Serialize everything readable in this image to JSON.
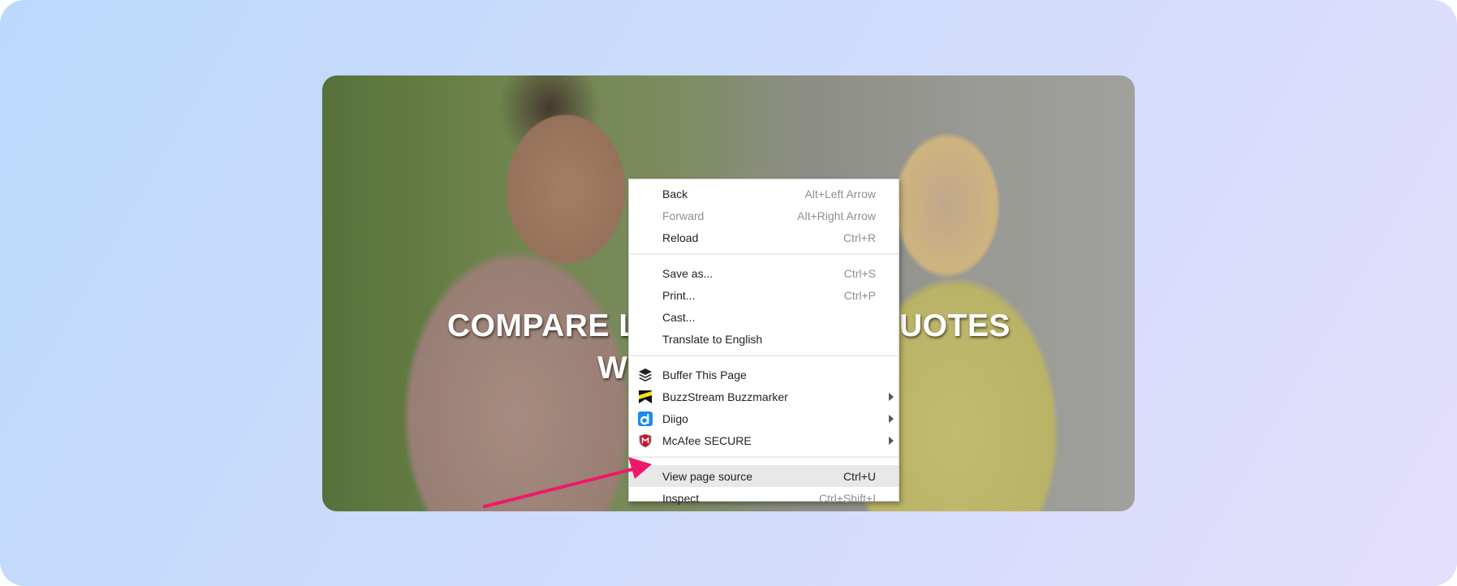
{
  "hero": {
    "headline_left": "COMPARE L",
    "headline_right": "UOTES",
    "headline_line2": "W"
  },
  "context_menu": {
    "groups": [
      [
        {
          "label": "Back",
          "shortcut": "Alt+Left Arrow",
          "enabled": true
        },
        {
          "label": "Forward",
          "shortcut": "Alt+Right Arrow",
          "enabled": false
        },
        {
          "label": "Reload",
          "shortcut": "Ctrl+R",
          "enabled": true
        }
      ],
      [
        {
          "label": "Save as...",
          "shortcut": "Ctrl+S",
          "enabled": true
        },
        {
          "label": "Print...",
          "shortcut": "Ctrl+P",
          "enabled": true
        },
        {
          "label": "Cast...",
          "enabled": true
        },
        {
          "label": "Translate to English",
          "enabled": true
        }
      ],
      [
        {
          "label": "Buffer This Page",
          "icon": "buffer-icon"
        },
        {
          "label": "BuzzStream Buzzmarker",
          "icon": "buzzstream-icon",
          "submenu": true
        },
        {
          "label": "Diigo",
          "icon": "diigo-icon",
          "submenu": true
        },
        {
          "label": "McAfee SECURE",
          "icon": "mcafee-icon",
          "submenu": true
        }
      ],
      [
        {
          "label": "View page source",
          "shortcut": "Ctrl+U",
          "highlighted": true
        },
        {
          "label": "Inspect",
          "shortcut": "Ctrl+Shift+I"
        }
      ]
    ]
  },
  "annotation": {
    "arrow_color": "#f0186a",
    "points_to": "View page source"
  }
}
